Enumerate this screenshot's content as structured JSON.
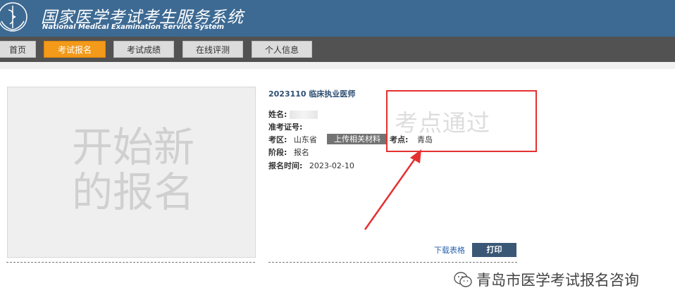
{
  "header": {
    "title_cn": "国家医学考试考生服务系统",
    "title_en": "National Medical Examination Service System",
    "logo_icon": "medical-emblem-icon"
  },
  "nav": {
    "items": [
      {
        "label": "首页",
        "active": false
      },
      {
        "label": "考试报名",
        "active": true
      },
      {
        "label": "考试成绩",
        "active": false
      },
      {
        "label": "在线评测",
        "active": false
      },
      {
        "label": "个人信息",
        "active": false
      }
    ],
    "active_color": "#f39a1a"
  },
  "new_registration": {
    "text": "开始新的报名"
  },
  "registration": {
    "exam_title": "2023110 临床执业医师",
    "name_label": "姓名:",
    "name_value": "",
    "ticket_label": "准考证号:",
    "ticket_value": "",
    "region_label": "考区:",
    "region_value": "山东省",
    "upload_button": "上传相关材料",
    "site_label": "考点:",
    "site_value": "青岛",
    "stage_label": "阶段:",
    "stage_value": "报名",
    "time_label": "报名时间:",
    "time_value": "2023-02-10",
    "download_link": "下载表格",
    "print_button": "打印"
  },
  "annotation": {
    "text": "考点通过",
    "color": "#e53030"
  },
  "watermark": {
    "icon": "wechat-icon",
    "text": "青岛市医学考试报名咨询"
  }
}
